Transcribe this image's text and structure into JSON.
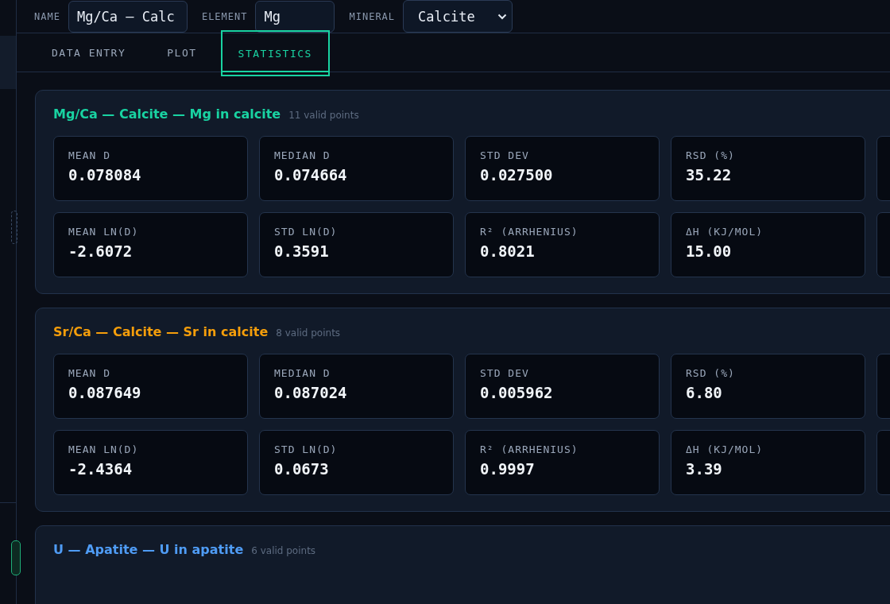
{
  "header": {
    "name_label": "NAME",
    "name_value": "Mg/Ca — Calc",
    "element_label": "ELEMENT",
    "element_value": "Mg",
    "mineral_label": "MINERAL",
    "mineral_value": "Calcite"
  },
  "tabs": [
    {
      "label": "DATA ENTRY",
      "selected": false
    },
    {
      "label": "PLOT",
      "selected": false
    },
    {
      "label": "STATISTICS",
      "selected": true
    }
  ],
  "sections": [
    {
      "title": "Mg/Ca — Calcite — Mg in calcite",
      "color": "#19d3a2",
      "count": "11 valid points",
      "stats": [
        {
          "label": "MEAN D",
          "value": "0.078084"
        },
        {
          "label": "MEDIAN D",
          "value": "0.074664"
        },
        {
          "label": "STD DEV",
          "value": "0.027500"
        },
        {
          "label": "RSD (%)",
          "value": "35.22"
        },
        {
          "label": "MEAN LN(D)",
          "value": "-2.6072"
        },
        {
          "label": "STD LN(D)",
          "value": "0.3591"
        },
        {
          "label": "R² (ARRHENIUS)",
          "value": "0.8021"
        },
        {
          "label": "ΔH (KJ/MOL)",
          "value": "15.00"
        }
      ]
    },
    {
      "title": "Sr/Ca — Calcite — Sr in calcite",
      "color": "#f59e0b",
      "count": "8 valid points",
      "stats": [
        {
          "label": "MEAN D",
          "value": "0.087649"
        },
        {
          "label": "MEDIAN D",
          "value": "0.087024"
        },
        {
          "label": "STD DEV",
          "value": "0.005962"
        },
        {
          "label": "RSD (%)",
          "value": "6.80"
        },
        {
          "label": "MEAN LN(D)",
          "value": "-2.4364"
        },
        {
          "label": "STD LN(D)",
          "value": "0.0673"
        },
        {
          "label": "R² (ARRHENIUS)",
          "value": "0.9997"
        },
        {
          "label": "ΔH (KJ/MOL)",
          "value": "3.39"
        }
      ]
    },
    {
      "title": "U — Apatite — U in apatite",
      "color": "#4f9cf5",
      "count": "6 valid points"
    }
  ]
}
